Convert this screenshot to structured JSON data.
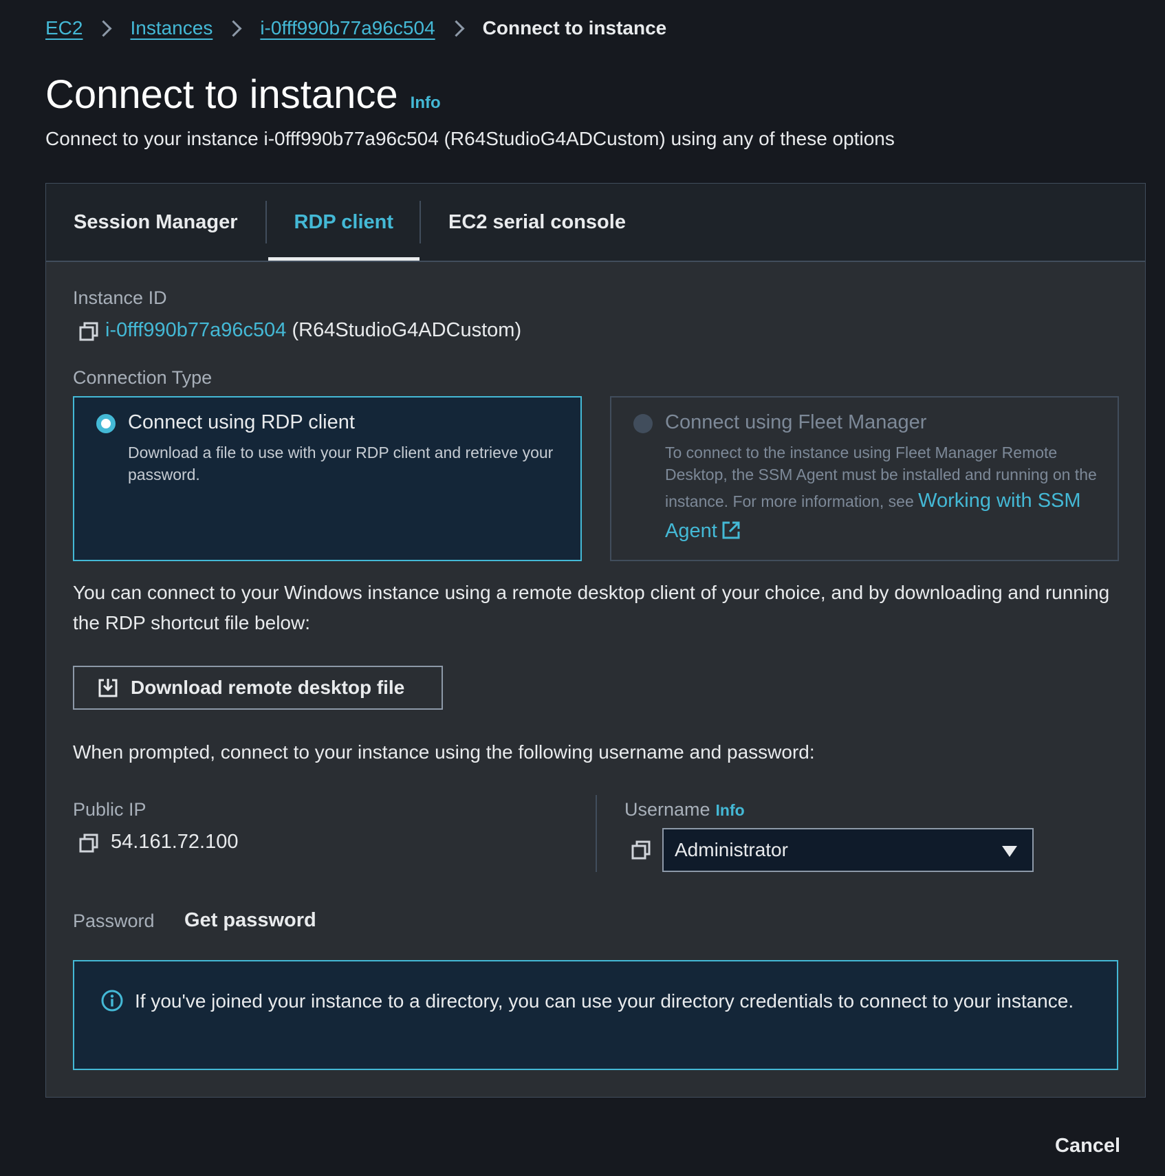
{
  "breadcrumb": {
    "items": [
      "EC2",
      "Instances",
      "i-0fff990b77a96c504"
    ],
    "current": "Connect to instance"
  },
  "header": {
    "title": "Connect to instance",
    "info": "Info",
    "description": "Connect to your instance i-0fff990b77a96c504 (R64StudioG4ADCustom) using any of these options"
  },
  "tabs": [
    {
      "label": "Session Manager",
      "active": false
    },
    {
      "label": "RDP client",
      "active": true
    },
    {
      "label": "EC2 serial console",
      "active": false
    }
  ],
  "instance": {
    "label": "Instance ID",
    "id": "i-0fff990b77a96c504",
    "name": "(R64StudioG4ADCustom)"
  },
  "connection_type": {
    "label": "Connection Type",
    "options": [
      {
        "title": "Connect using RDP client",
        "description": "Download a file to use with your RDP client and retrieve your password.",
        "selected": true
      },
      {
        "title": "Connect using Fleet Manager",
        "description": "To connect to the instance using Fleet Manager Remote Desktop, the SSM Agent must be installed and running on the instance. For more information, see",
        "link": "Working with SSM Agent",
        "selected": false,
        "disabled": true
      }
    ]
  },
  "rdp": {
    "intro": "You can connect to your Windows instance using a remote desktop client of your choice, and by downloading and running the RDP shortcut file below:",
    "download_label": "Download remote desktop file",
    "prompt": "When prompted, connect to your instance using the following username and password:"
  },
  "public_ip": {
    "label": "Public IP",
    "value": "54.161.72.100"
  },
  "username": {
    "label": "Username",
    "info": "Info",
    "value": "Administrator"
  },
  "password": {
    "label": "Password",
    "action": "Get password"
  },
  "alert": {
    "text": "If you've joined your instance to a directory, you can use your directory credentials to connect to your instance."
  },
  "footer": {
    "cancel_label": "Cancel"
  },
  "colors": {
    "accent": "#44b9d6",
    "background": "#16191f",
    "panel": "#2a2e33"
  }
}
